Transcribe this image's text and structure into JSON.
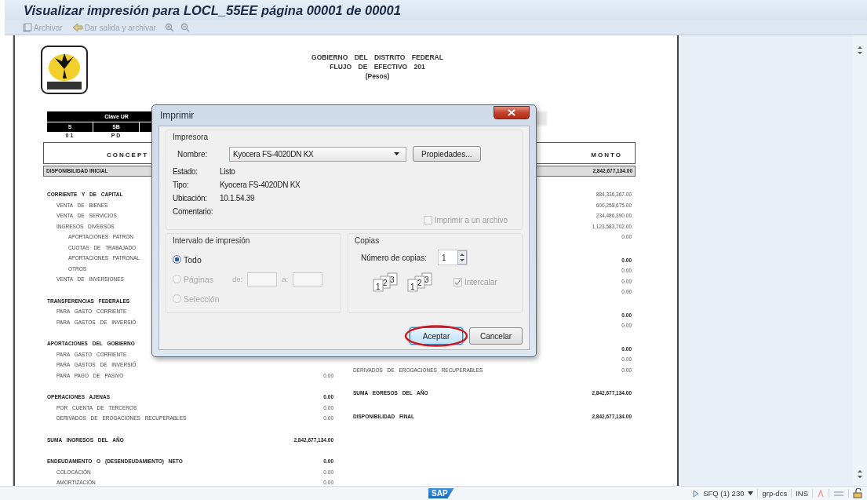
{
  "window": {
    "title": "Visualizar impresión para LOCL_55EE página 00001 de 00001"
  },
  "toolbar": {
    "buttons": [
      {
        "label": "Archivar",
        "kind": "archive",
        "disabled": true
      },
      {
        "label": "Dar salida y archivar",
        "kind": "output",
        "disabled": true
      }
    ]
  },
  "report": {
    "header_lines": [
      "GOBIERNO DEL DISTRITO FEDERAL",
      "FLUJO DE EFECTIVO 201",
      "(Pesos)"
    ],
    "clave_ur": {
      "title": "Clave UR",
      "columns": [
        "S",
        "SB"
      ],
      "values": [
        "01",
        "PD"
      ]
    },
    "table_header": {
      "concept": "CONCEPT",
      "amount": "MONTO"
    },
    "opening": {
      "label": "DISPONIBILIDAD INICIAL",
      "amount": "2,842,677,134.00"
    },
    "income": [
      {
        "label": "CORRIENTE Y DE CAPITAL",
        "children": [
          {
            "label": "VENTA DE BIENES"
          },
          {
            "label": "VENTA DE SERVICIOS"
          },
          {
            "label": "INGRESOS DIVERSOS",
            "children": [
              {
                "label": "APORTACIONES PATRON"
              },
              {
                "label": "CUOTAS DE TRABAJADO"
              },
              {
                "label": "APORTACIONES PATRONAL"
              },
              {
                "label": "OTROS"
              }
            ]
          },
          {
            "label": "VENTA DE INVERSIONES"
          }
        ]
      },
      {
        "label": "TRANSFERENCIAS FEDERALES",
        "children": [
          {
            "label": "PARA GASTO CORRIENTE"
          },
          {
            "label": "PARA GASTOS DE INVERSIÓ"
          }
        ]
      },
      {
        "label": "APORTACIONES DEL GOBIERNO",
        "children": [
          {
            "label": "PARA GASTO CORRIENTE"
          },
          {
            "label": "PARA GASTOS DE INVERSIÓ"
          },
          {
            "label": "PARA PAGO DE PASIVO",
            "amount": "0.00"
          }
        ]
      },
      {
        "label": "OPERACIONES AJENAS",
        "amount": "0.00",
        "children": [
          {
            "label": "POR CUENTA DE TERCEROS",
            "amount": "0.00"
          },
          {
            "label": "DERIVADOS DE EROGACIONES RECUPERABLES",
            "amount": "0.00"
          }
        ]
      },
      {
        "label": "SUMA INGRESOS DEL AÑO",
        "amount": "2,842,677,134.00"
      },
      {
        "label": "ENDEUDAMIENTO O (DESENDEUDAMIENTO) NETO",
        "amount": "0.00",
        "children": [
          {
            "label": "COLOCACIÓN",
            "amount": "0.00"
          },
          {
            "label": "AMORTIZACIÓN",
            "amount": "0.00"
          }
        ]
      }
    ],
    "expenses": [
      {
        "rows": [
          {
            "kind": "item",
            "amount": "884,336,367.00"
          },
          {
            "kind": "item",
            "amount": "600,258,675.00"
          },
          {
            "kind": "item",
            "amount": "234,486,390.00"
          },
          {
            "kind": "item",
            "amount": "1,123,583,702.00"
          },
          {
            "kind": "item",
            "amount": "0.00"
          }
        ]
      },
      {
        "rows": [
          {
            "kind": "heading",
            "amount": "0.00"
          },
          {
            "kind": "item",
            "amount": "0.00"
          },
          {
            "kind": "item",
            "amount": "0.00"
          },
          {
            "kind": "item",
            "amount": "0.00"
          }
        ]
      },
      {
        "rows": [
          {
            "kind": "heading",
            "amount": "0.00"
          },
          {
            "kind": "item",
            "amount": "0.00"
          }
        ]
      },
      {
        "rows": [
          {
            "kind": "heading",
            "amount": "0.00"
          },
          {
            "kind": "item",
            "amount": "0.00"
          },
          {
            "kind": "item",
            "label": "DERIVADOS DE EROGACIONES RECUPERABLES",
            "amount": "0.00"
          }
        ]
      },
      {
        "rows": [
          {
            "kind": "total",
            "label": "SUMA EGRESOS DEL AÑO",
            "amount": "2,842,677,134.00"
          }
        ]
      },
      {
        "rows": [
          {
            "kind": "total",
            "label": "DISPONIBILIDAD FINAL",
            "amount": "2,842,677,134.00"
          }
        ]
      }
    ]
  },
  "dialog": {
    "title": "Imprimir",
    "printer": {
      "group": "Impresora",
      "name_label": "Nombre:",
      "name_value": "Kyocera FS-4020DN KX",
      "properties_button": "Propiedades...",
      "info": [
        {
          "label": "Estado:",
          "value": "Listo"
        },
        {
          "label": "Tipo:",
          "value": "Kyocera FS-4020DN KX"
        },
        {
          "label": "Ubicación:",
          "value": "10.1.54.39"
        },
        {
          "label": "Comentario:"
        }
      ],
      "print_to_file": {
        "label": "Imprimir a un archivo",
        "checked": false,
        "disabled": true
      }
    },
    "range": {
      "group": "Intervalo de impresión",
      "options": [
        {
          "kind": "plain",
          "label": "Todo",
          "selected": true,
          "disabled": false
        },
        {
          "kind": "pages",
          "label": "Páginas",
          "selected": false,
          "disabled": true,
          "from_label": "de:",
          "to_label": "a:"
        },
        {
          "kind": "plain",
          "label": "Selección",
          "selected": false,
          "disabled": true
        }
      ]
    },
    "copies": {
      "group": "Copias",
      "count_label": "Número de copias:",
      "count_value": "1",
      "collate_digits": [
        [
          "1",
          "2",
          "3"
        ],
        [
          "1",
          "2",
          "3"
        ]
      ],
      "collate": {
        "label": "Intercalar",
        "checked": true,
        "disabled": true
      }
    },
    "buttons": [
      {
        "label": "Aceptar",
        "kind": "primary",
        "highlighted": true
      },
      {
        "label": "Cancelar",
        "kind": "secondary",
        "highlighted": false
      }
    ]
  },
  "status_bar": {
    "logo": "SAP",
    "system": "SFQ (1) 230",
    "server": "grp-dcs",
    "mode": "INS"
  }
}
